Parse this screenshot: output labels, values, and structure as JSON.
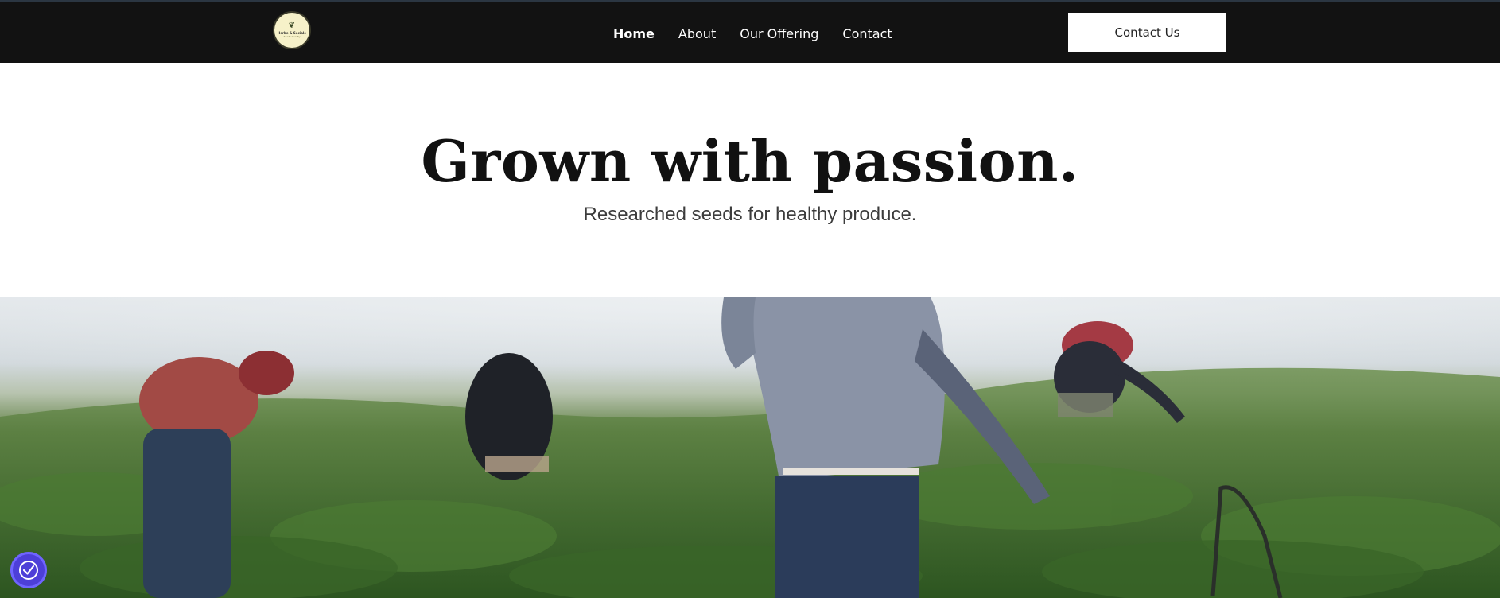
{
  "header": {
    "logo": {
      "name_line": "Herbe & Sociale",
      "tagline": "Seeds Quality"
    },
    "nav": [
      {
        "label": "Home",
        "active": true
      },
      {
        "label": "About",
        "active": false
      },
      {
        "label": "Our Offering",
        "active": false
      },
      {
        "label": "Contact",
        "active": false
      }
    ],
    "cta_label": "Contact Us"
  },
  "hero": {
    "headline": "Grown with passion.",
    "subheadline": "Researched seeds for healthy produce."
  },
  "photo": {
    "subject": "people working in a green field"
  },
  "icons": {
    "accessibility": "accessibility-icon",
    "logo_sprout": "sprout-icon"
  },
  "colors": {
    "header_bg": "#121212",
    "accessibility_bg": "#4d3fd8"
  }
}
